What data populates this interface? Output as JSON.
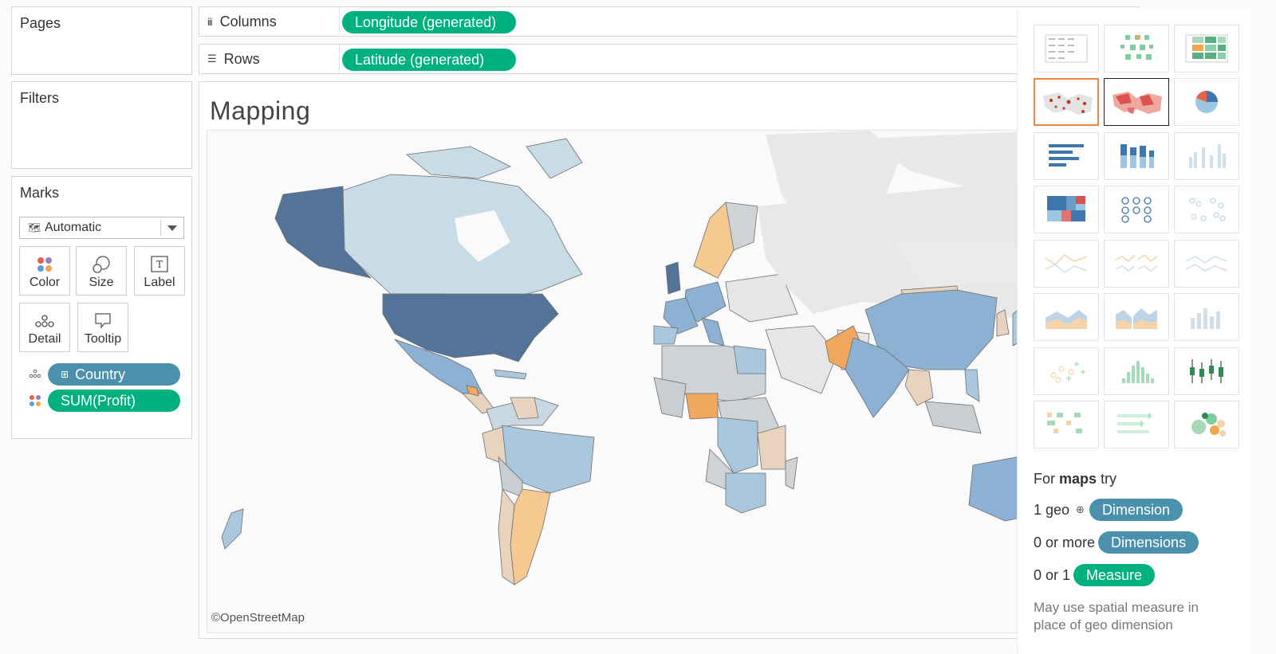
{
  "cards": {
    "pages_title": "Pages",
    "filters_title": "Filters",
    "marks_title": "Marks"
  },
  "marks": {
    "type_value": "Automatic",
    "buttons": [
      "Color",
      "Size",
      "Label",
      "Detail",
      "Tooltip"
    ],
    "pills": [
      {
        "text": "Country",
        "kind": "dimension"
      },
      {
        "text": "SUM(Profit)",
        "kind": "measure"
      }
    ]
  },
  "shelves": {
    "columns_label": "Columns",
    "columns_pill": "Longitude (generated)",
    "rows_label": "Rows",
    "rows_pill": "Latitude (generated)"
  },
  "view": {
    "title": "Mapping",
    "credit": "©OpenStreetMap"
  },
  "show_me": {
    "hint_prefix": "For",
    "hint_bold": "maps",
    "hint_suffix": "try",
    "req_geo_label": "1 geo",
    "req_geo_pill": "Dimension",
    "req_dims_label": "0 or more",
    "req_dims_pill": "Dimensions",
    "req_measure_label": "0 or 1",
    "req_measure_pill": "Measure",
    "note": "May use spatial measure in place of geo dimension",
    "selected_chart": "symbol-map",
    "highlighted_chart": "filled-map"
  },
  "colors": {
    "measure_green": "#00b180",
    "dimension_blue": "#4b90ad",
    "selected_orange": "#e8874a"
  }
}
